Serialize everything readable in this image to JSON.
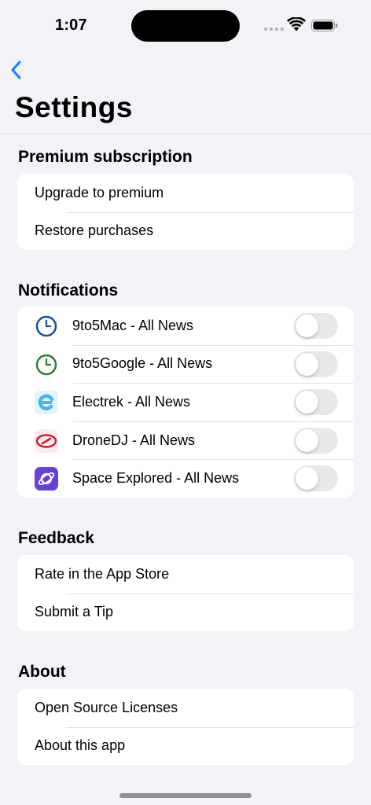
{
  "status_bar": {
    "time": "1:07"
  },
  "nav": {
    "title": "Settings",
    "back_icon": "chevron-left-icon"
  },
  "sections": {
    "premium": {
      "header": "Premium subscription",
      "items": [
        {
          "label": "Upgrade to premium"
        },
        {
          "label": "Restore purchases"
        }
      ]
    },
    "notifications": {
      "header": "Notifications",
      "items": [
        {
          "label": "9to5Mac - All News",
          "icon": "clock-icon-blue",
          "enabled": false
        },
        {
          "label": "9to5Google - All News",
          "icon": "clock-icon-green",
          "enabled": false
        },
        {
          "label": "Electrek - All News",
          "icon": "electrek-e-icon",
          "enabled": false
        },
        {
          "label": "DroneDJ - All News",
          "icon": "dronedj-icon",
          "enabled": false
        },
        {
          "label": "Space Explored - All News",
          "icon": "planet-icon",
          "enabled": false
        }
      ]
    },
    "feedback": {
      "header": "Feedback",
      "items": [
        {
          "label": "Rate in the App Store"
        },
        {
          "label": "Submit a Tip"
        }
      ]
    },
    "about": {
      "header": "About",
      "items": [
        {
          "label": "Open Source Licenses"
        },
        {
          "label": "About this app"
        }
      ]
    }
  },
  "colors": {
    "accent": "#0a84ff",
    "background": "#f2f2f7",
    "toggle_off": "#e9e9eb"
  }
}
